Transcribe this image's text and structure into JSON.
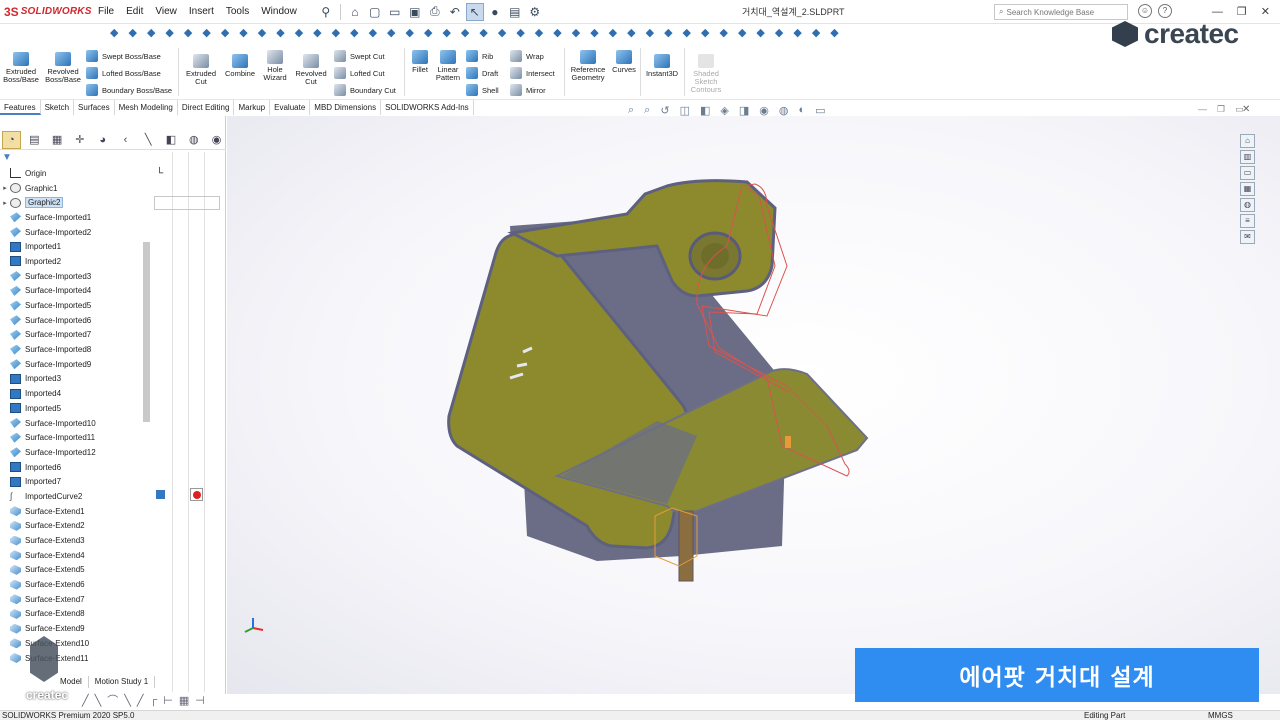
{
  "app": {
    "logo_prefix": "3S",
    "logo_text": "SOLIDWORKS"
  },
  "menu": [
    "File",
    "Edit",
    "View",
    "Insert",
    "Tools",
    "Window"
  ],
  "document_title": "거치대_역설계_2.SLDPRT",
  "search": {
    "placeholder": "Search Knowledge Base"
  },
  "brand_watermark": "createc",
  "ribbon": {
    "extruded_boss": "Extruded Boss/Base",
    "revolved_boss": "Revolved Boss/Base",
    "swept_boss": "Swept Boss/Base",
    "lofted_boss": "Lofted Boss/Base",
    "boundary_boss": "Boundary Boss/Base",
    "extruded_cut": "Extruded Cut",
    "combine": "Combine",
    "hole_wizard": "Hole Wizard",
    "revolved_cut": "Revolved Cut",
    "swept_cut": "Swept Cut",
    "lofted_cut": "Lofted Cut",
    "boundary_cut": "Boundary Cut",
    "fillet": "Fillet",
    "linear_pattern": "Linear Pattern",
    "rib": "Rib",
    "draft": "Draft",
    "shell": "Shell",
    "wrap": "Wrap",
    "intersect": "Intersect",
    "mirror": "Mirror",
    "reference_geometry": "Reference Geometry",
    "curves": "Curves",
    "instant3d": "Instant3D",
    "shaded_sketch": "Shaded Sketch Contours"
  },
  "tabs": [
    "Features",
    "Sketch",
    "Surfaces",
    "Mesh Modeling",
    "Direct Editing",
    "Markup",
    "Evaluate",
    "MBD Dimensions",
    "SOLIDWORKS Add-Ins"
  ],
  "active_tab": "Features",
  "feature_tree": [
    {
      "label": "Origin",
      "icon": "origin"
    },
    {
      "label": "Graphic1",
      "icon": "graphic",
      "expand": true
    },
    {
      "label": "Graphic2",
      "icon": "graphic",
      "expand": true,
      "selected": true
    },
    {
      "label": "Surface-Imported1",
      "icon": "surface"
    },
    {
      "label": "Surface-Imported2",
      "icon": "surface"
    },
    {
      "label": "Imported1",
      "icon": "imported"
    },
    {
      "label": "Imported2",
      "icon": "imported"
    },
    {
      "label": "Surface-Imported3",
      "icon": "surface"
    },
    {
      "label": "Surface-Imported4",
      "icon": "surface"
    },
    {
      "label": "Surface-Imported5",
      "icon": "surface"
    },
    {
      "label": "Surface-Imported6",
      "icon": "surface"
    },
    {
      "label": "Surface-Imported7",
      "icon": "surface"
    },
    {
      "label": "Surface-Imported8",
      "icon": "surface"
    },
    {
      "label": "Surface-Imported9",
      "icon": "surface"
    },
    {
      "label": "Imported3",
      "icon": "imported"
    },
    {
      "label": "Imported4",
      "icon": "imported"
    },
    {
      "label": "Imported5",
      "icon": "imported"
    },
    {
      "label": "Surface-Imported10",
      "icon": "surface"
    },
    {
      "label": "Surface-Imported11",
      "icon": "surface"
    },
    {
      "label": "Surface-Imported12",
      "icon": "surface"
    },
    {
      "label": "Imported6",
      "icon": "imported"
    },
    {
      "label": "Imported7",
      "icon": "imported"
    },
    {
      "label": "ImportedCurve2",
      "icon": "curve"
    },
    {
      "label": "Surface-Extend1",
      "icon": "extend"
    },
    {
      "label": "Surface-Extend2",
      "icon": "extend"
    },
    {
      "label": "Surface-Extend3",
      "icon": "extend"
    },
    {
      "label": "Surface-Extend4",
      "icon": "extend"
    },
    {
      "label": "Surface-Extend5",
      "icon": "extend"
    },
    {
      "label": "Surface-Extend6",
      "icon": "extend"
    },
    {
      "label": "Surface-Extend7",
      "icon": "extend"
    },
    {
      "label": "Surface-Extend8",
      "icon": "extend"
    },
    {
      "label": "Surface-Extend9",
      "icon": "extend"
    },
    {
      "label": "Surface-Extend10",
      "icon": "extend"
    },
    {
      "label": "Surface-Extend11",
      "icon": "extend"
    }
  ],
  "bottom_tabs": [
    "Model",
    "Motion Study 1"
  ],
  "caption": "에어팟 거치대 설계",
  "status": {
    "left": "SOLIDWORKS Premium 2020 SP5.0",
    "mode": "Editing Part",
    "units": "MMGS"
  },
  "colors": {
    "accent": "#2f8cf0",
    "model_face": "#8c8a2c",
    "model_edge": "#6c6e88",
    "sketch": "#d9534f"
  }
}
